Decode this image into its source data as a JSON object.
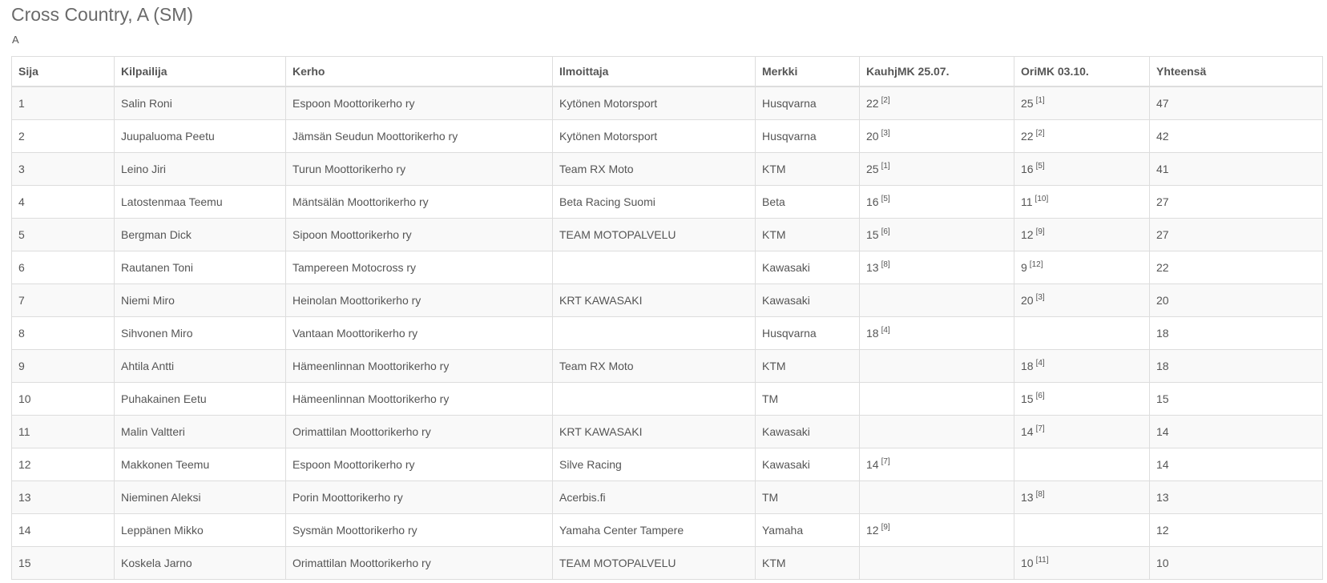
{
  "page": {
    "title": "Cross Country, A (SM)",
    "subtitle": "A"
  },
  "table": {
    "columns": [
      "Sija",
      "Kilpailija",
      "Kerho",
      "Ilmoittaja",
      "Merkki",
      "KauhjMK 25.07.",
      "OriMK 03.10.",
      "Yhteensä"
    ],
    "rows": [
      {
        "sija": "1",
        "kilpailija": "Salin Roni",
        "kerho": "Espoon Moottorikerho ry",
        "ilmoittaja": "Kytönen Motorsport",
        "merkki": "Husqvarna",
        "r1": "22",
        "r1_pos": "[2]",
        "r2": "25",
        "r2_pos": "[1]",
        "total": "47"
      },
      {
        "sija": "2",
        "kilpailija": "Juupaluoma Peetu",
        "kerho": "Jämsän Seudun Moottorikerho ry",
        "ilmoittaja": "Kytönen Motorsport",
        "merkki": "Husqvarna",
        "r1": "20",
        "r1_pos": "[3]",
        "r2": "22",
        "r2_pos": "[2]",
        "total": "42"
      },
      {
        "sija": "3",
        "kilpailija": "Leino Jiri",
        "kerho": "Turun Moottorikerho ry",
        "ilmoittaja": "Team RX Moto",
        "merkki": "KTM",
        "r1": "25",
        "r1_pos": "[1]",
        "r2": "16",
        "r2_pos": "[5]",
        "total": "41"
      },
      {
        "sija": "4",
        "kilpailija": "Latostenmaa Teemu",
        "kerho": "Mäntsälän Moottorikerho ry",
        "ilmoittaja": "Beta Racing Suomi",
        "merkki": "Beta",
        "r1": "16",
        "r1_pos": "[5]",
        "r2": "11",
        "r2_pos": "[10]",
        "total": "27"
      },
      {
        "sija": "5",
        "kilpailija": "Bergman Dick",
        "kerho": "Sipoon Moottorikerho ry",
        "ilmoittaja": "TEAM MOTOPALVELU",
        "merkki": "KTM",
        "r1": "15",
        "r1_pos": "[6]",
        "r2": "12",
        "r2_pos": "[9]",
        "total": "27"
      },
      {
        "sija": "6",
        "kilpailija": "Rautanen Toni",
        "kerho": "Tampereen Motocross ry",
        "ilmoittaja": "",
        "merkki": "Kawasaki",
        "r1": "13",
        "r1_pos": "[8]",
        "r2": "9",
        "r2_pos": "[12]",
        "total": "22"
      },
      {
        "sija": "7",
        "kilpailija": "Niemi Miro",
        "kerho": "Heinolan Moottorikerho ry",
        "ilmoittaja": "KRT KAWASAKI",
        "merkki": "Kawasaki",
        "r1": "",
        "r1_pos": "",
        "r2": "20",
        "r2_pos": "[3]",
        "total": "20"
      },
      {
        "sija": "8",
        "kilpailija": "Sihvonen Miro",
        "kerho": "Vantaan Moottorikerho ry",
        "ilmoittaja": "",
        "merkki": "Husqvarna",
        "r1": "18",
        "r1_pos": "[4]",
        "r2": "",
        "r2_pos": "",
        "total": "18"
      },
      {
        "sija": "9",
        "kilpailija": "Ahtila Antti",
        "kerho": "Hämeenlinnan Moottorikerho ry",
        "ilmoittaja": "Team RX Moto",
        "merkki": "KTM",
        "r1": "",
        "r1_pos": "",
        "r2": "18",
        "r2_pos": "[4]",
        "total": "18"
      },
      {
        "sija": "10",
        "kilpailija": "Puhakainen Eetu",
        "kerho": "Hämeenlinnan Moottorikerho ry",
        "ilmoittaja": "",
        "merkki": "TM",
        "r1": "",
        "r1_pos": "",
        "r2": "15",
        "r2_pos": "[6]",
        "total": "15"
      },
      {
        "sija": "11",
        "kilpailija": "Malin Valtteri",
        "kerho": "Orimattilan Moottorikerho ry",
        "ilmoittaja": "KRT KAWASAKI",
        "merkki": "Kawasaki",
        "r1": "",
        "r1_pos": "",
        "r2": "14",
        "r2_pos": "[7]",
        "total": "14"
      },
      {
        "sija": "12",
        "kilpailija": "Makkonen Teemu",
        "kerho": "Espoon Moottorikerho ry",
        "ilmoittaja": "Silve Racing",
        "merkki": "Kawasaki",
        "r1": "14",
        "r1_pos": "[7]",
        "r2": "",
        "r2_pos": "",
        "total": "14"
      },
      {
        "sija": "13",
        "kilpailija": "Nieminen Aleksi",
        "kerho": "Porin Moottorikerho ry",
        "ilmoittaja": "Acerbis.fi",
        "merkki": "TM",
        "r1": "",
        "r1_pos": "",
        "r2": "13",
        "r2_pos": "[8]",
        "total": "13"
      },
      {
        "sija": "14",
        "kilpailija": "Leppänen Mikko",
        "kerho": "Sysmän Moottorikerho ry",
        "ilmoittaja": "Yamaha Center Tampere",
        "merkki": "Yamaha",
        "r1": "12",
        "r1_pos": "[9]",
        "r2": "",
        "r2_pos": "",
        "total": "12"
      },
      {
        "sija": "15",
        "kilpailija": "Koskela Jarno",
        "kerho": "Orimattilan Moottorikerho ry",
        "ilmoittaja": "TEAM MOTOPALVELU",
        "merkki": "KTM",
        "r1": "",
        "r1_pos": "",
        "r2": "10",
        "r2_pos": "[11]",
        "total": "10"
      }
    ]
  }
}
